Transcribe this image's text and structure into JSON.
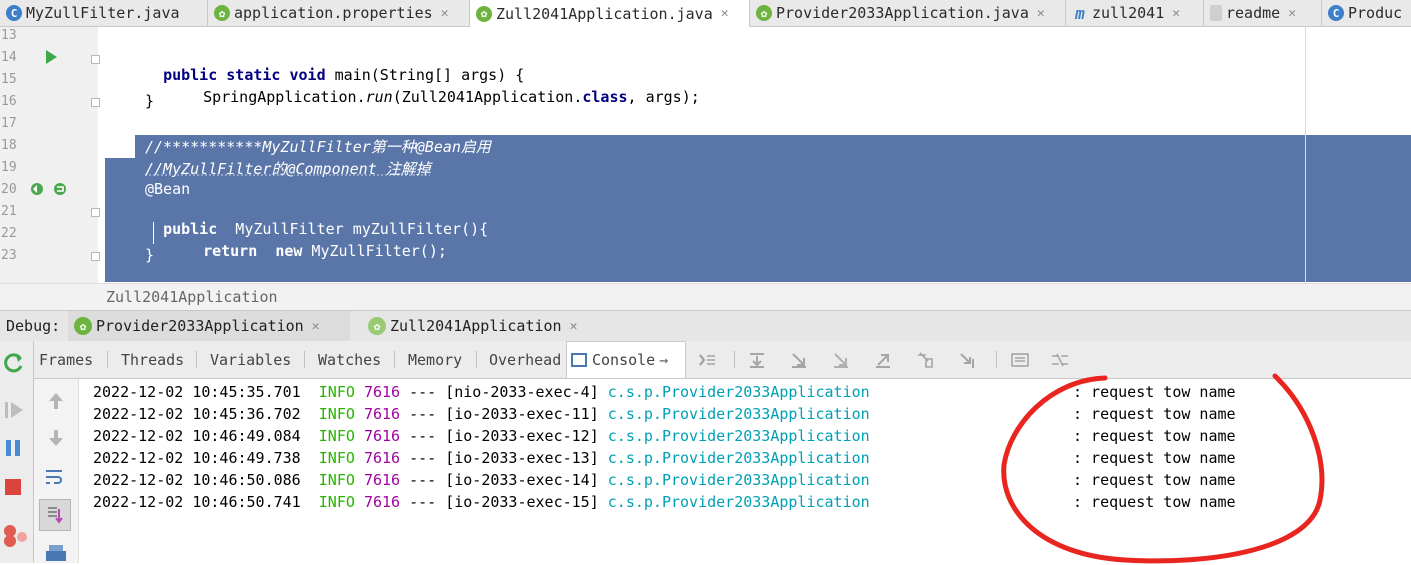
{
  "tabs": [
    {
      "icon": "C",
      "icon_type": "class-icon",
      "label": "MyZullFilter.java",
      "active": false
    },
    {
      "icon": "",
      "icon_type": "spring-properties-icon",
      "label": "application.properties",
      "active": false
    },
    {
      "icon": "",
      "icon_type": "spring-class-icon",
      "label": "Zull2041Application.java",
      "active": true
    },
    {
      "icon": "",
      "icon_type": "spring-class-icon",
      "label": "Provider2033Application.java",
      "active": false
    },
    {
      "icon": "m",
      "icon_type": "maven-icon",
      "label": "zull2041",
      "active": false
    },
    {
      "icon": "",
      "icon_type": "document-icon",
      "label": "readme",
      "active": false
    },
    {
      "icon": "C",
      "icon_type": "class-icon",
      "label": "Produc",
      "active": false
    }
  ],
  "editor": {
    "line_numbers": [
      "13",
      "14",
      "15",
      "16",
      "17",
      "18",
      "19",
      "20",
      "21",
      "22",
      "23"
    ],
    "lines": {
      "l14_kw": "public static void",
      "l14_rest": " main(String[] args) {",
      "l15_a": "SpringApplication.",
      "l15_run": "run",
      "l15_b": "(Zull2041Application.",
      "l15_kw": "class",
      "l15_c": ", args);",
      "l16": "}",
      "l18": "//***********MyZullFilter第一种@Bean启用",
      "l19": "//MyZullFilter的@Component 注解掉",
      "l20": "@Bean",
      "l21_kw": "public",
      "l21_rest": "  MyZullFilter myZullFilter(){",
      "l22_kw1": "return",
      "l22_kw2": "new",
      "l22_rest": " MyZullFilter();",
      "l23": "}"
    }
  },
  "breadcrumb": "Zull2041Application",
  "debug": {
    "label": "Debug:",
    "sessions": [
      {
        "label": "Provider2033Application",
        "active": true
      },
      {
        "label": "Zull2041Application",
        "active": false
      }
    ],
    "subtabs": [
      "Frames",
      "Threads",
      "Variables",
      "Watches",
      "Memory",
      "Overhead",
      "Console"
    ],
    "active_subtab": "Console"
  },
  "console": {
    "lines": [
      {
        "ts": "2022-12-02 10:45:35.701",
        "level": "INFO",
        "pid": "7616",
        "sep": "---",
        "thread": "[nio-2033-exec-4]",
        "logger": "c.s.p.Provider2033Application",
        "msg": ": request tow name"
      },
      {
        "ts": "2022-12-02 10:45:36.702",
        "level": "INFO",
        "pid": "7616",
        "sep": "---",
        "thread": "[io-2033-exec-11]",
        "logger": "c.s.p.Provider2033Application",
        "msg": ": request tow name"
      },
      {
        "ts": "2022-12-02 10:46:49.084",
        "level": "INFO",
        "pid": "7616",
        "sep": "---",
        "thread": "[io-2033-exec-12]",
        "logger": "c.s.p.Provider2033Application",
        "msg": ": request tow name"
      },
      {
        "ts": "2022-12-02 10:46:49.738",
        "level": "INFO",
        "pid": "7616",
        "sep": "---",
        "thread": "[io-2033-exec-13]",
        "logger": "c.s.p.Provider2033Application",
        "msg": ": request tow name"
      },
      {
        "ts": "2022-12-02 10:46:50.086",
        "level": "INFO",
        "pid": "7616",
        "sep": "---",
        "thread": "[io-2033-exec-14]",
        "logger": "c.s.p.Provider2033Application",
        "msg": ": request tow name"
      },
      {
        "ts": "2022-12-02 10:46:50.741",
        "level": "INFO",
        "pid": "7616",
        "sep": "---",
        "thread": "[io-2033-exec-15]",
        "logger": "c.s.p.Provider2033Application",
        "msg": ": request tow name"
      }
    ]
  },
  "colors": {
    "selection": "#5a76a9",
    "keyword": "#000080",
    "info": "#27b300",
    "pid": "#a100a1",
    "logger": "#00a0b4",
    "annotation_circle": "#e8261f"
  }
}
